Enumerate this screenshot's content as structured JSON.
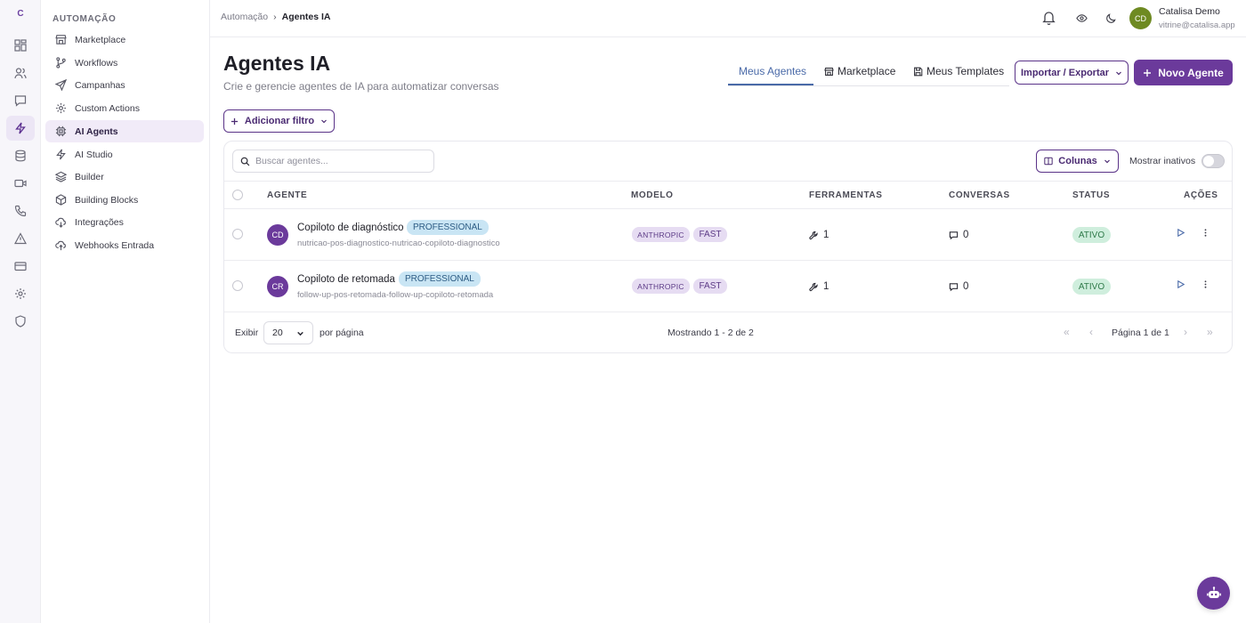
{
  "rail": {
    "logo": "C"
  },
  "sidebar": {
    "section_title": "AUTOMAÇÃO",
    "items": [
      {
        "label": "Marketplace",
        "icon": "store-icon"
      },
      {
        "label": "Workflows",
        "icon": "git-branch-icon"
      },
      {
        "label": "Campanhas",
        "icon": "send-icon"
      },
      {
        "label": "Custom Actions",
        "icon": "gear-icon"
      },
      {
        "label": "AI Agents",
        "icon": "cpu-chip-icon",
        "active": true
      },
      {
        "label": "AI Studio",
        "icon": "zap-icon"
      },
      {
        "label": "Builder",
        "icon": "layers-icon"
      },
      {
        "label": "Building Blocks",
        "icon": "cube-icon"
      },
      {
        "label": "Integrações",
        "icon": "cloud-sync-icon"
      },
      {
        "label": "Webhooks Entrada",
        "icon": "cloud-in-icon"
      }
    ]
  },
  "topbar": {
    "breadcrumb": {
      "parent": "Automação",
      "separator": "›",
      "current": "Agentes IA"
    },
    "user": {
      "initials": "CD",
      "name": "Catalisa Demo",
      "email": "vitrine@catalisa.app"
    }
  },
  "header": {
    "title": "Agentes IA",
    "subtitle": "Crie e gerencie agentes de IA para automatizar conversas",
    "tabs": [
      {
        "label": "Meus Agentes",
        "active": true
      },
      {
        "label": "Marketplace",
        "icon": "store-icon"
      },
      {
        "label": "Meus Templates",
        "icon": "save-icon"
      }
    ],
    "import_export_label": "Importar / Exportar",
    "new_agent_label": "Novo Agente"
  },
  "filters": {
    "add_filter_label": "Adicionar filtro"
  },
  "table": {
    "search_placeholder": "Buscar agentes...",
    "columns_label": "Colunas",
    "show_inactive_label": "Mostrar inativos",
    "show_inactive": false,
    "headers": {
      "agent": "AGENTE",
      "model": "MODELO",
      "tools": "FERRAMENTAS",
      "conversations": "CONVERSAS",
      "status": "STATUS",
      "actions": "AÇÕES"
    },
    "rows": [
      {
        "initials": "CD",
        "name": "Copiloto de diagnóstico",
        "tier": "PROFESSIONAL",
        "slug": "nutricao-pos-diagnostico-nutricao-copiloto-diagnostico",
        "provider": "ANTHROPIC",
        "speed": "FAST",
        "tools": "1",
        "conversations": "0",
        "status": "ATIVO"
      },
      {
        "initials": "CR",
        "name": "Copiloto de retomada",
        "tier": "PROFESSIONAL",
        "slug": "follow-up-pos-retomada-follow-up-copiloto-retomada",
        "provider": "ANTHROPIC",
        "speed": "FAST",
        "tools": "1",
        "conversations": "0",
        "status": "ATIVO"
      }
    ],
    "footer": {
      "show_label": "Exibir",
      "per_page_value": "20",
      "per_page_label": "por página",
      "showing": "Mostrando 1 - 2 de 2",
      "page_label": "Página 1 de 1",
      "first": "«",
      "prev": "‹",
      "next": "›",
      "last": "»"
    }
  },
  "colors": {
    "brand": "#6b3a9b",
    "active_tab": "#4a6aa8",
    "status_active_bg": "#cfeedd",
    "tier_badge_bg": "#c9e5f4",
    "model_pill_bg": "#e6dcf2"
  }
}
